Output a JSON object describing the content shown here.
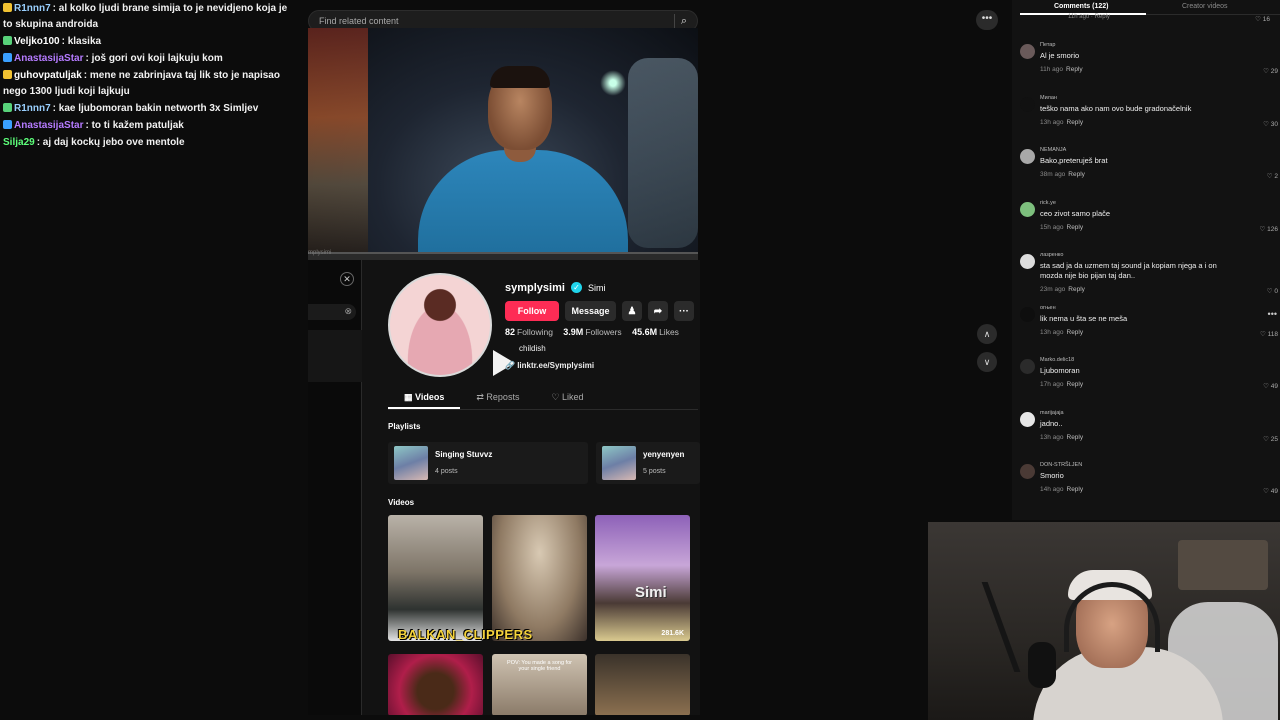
{
  "chat": {
    "messages": [
      {
        "user": "R1nnn7",
        "user_color": "#9ad0ff",
        "badge_color": "#f1c232",
        "text": ": al kolko ljudi brane simija to je nevidjeno koja je to skupina androida"
      },
      {
        "user": "Veljko100",
        "user_color": "#ffffff",
        "badge_color": "#58d27a",
        "text": ": klasika"
      },
      {
        "user": "AnastasijaStar",
        "user_color": "#b57bff",
        "badge_color": "#3aa0ff",
        "text": ": još gori ovi koji lajkuju kom"
      },
      {
        "user": "guhovpatuljak",
        "user_color": "#ffffff",
        "badge_color": "#f1c232",
        "text": ": mene ne zabrinjava taj lik sto je napisao nego 1300 ljudi koji lajkuju"
      },
      {
        "user": "R1nnn7",
        "user_color": "#9ad0ff",
        "badge_color": "#58d27a",
        "text": ": kae ljubomoran bakin networth 3x Simljev"
      },
      {
        "user": "AnastasijaStar",
        "user_color": "#b57bff",
        "badge_color": "#3aa0ff",
        "text": ": to ti kažem patuljak"
      },
      {
        "user": "Silja29",
        "user_color": "#5dff7a",
        "badge_color": "",
        "text": ": aj daj kockų jebo ove mentole"
      }
    ]
  },
  "search": {
    "placeholder": "Find related content",
    "icon": "search-icon"
  },
  "video": {
    "label": "mplysimi",
    "progress_pct": 100
  },
  "profile": {
    "username": "symplysimi",
    "nickname": "Simi",
    "follow_label": "Follow",
    "message_label": "Message",
    "following_count": "82",
    "following_label": "Following",
    "followers_count": "3.9M",
    "followers_label": "Followers",
    "likes_count": "45.6M",
    "likes_label": "Likes",
    "bio": "childish",
    "link": "linktr.ee/Symplysimi",
    "tabs": [
      "Videos",
      "Reposts",
      "Liked"
    ],
    "playlists_label": "Playlists",
    "playlists": [
      {
        "name": "Singing Stuvvz",
        "count": "4 posts"
      },
      {
        "name": "yenyenyen",
        "count": "5 posts"
      }
    ],
    "videos_label": "Videos",
    "videos": [
      {
        "views": ""
      },
      {
        "views": ""
      },
      {
        "views": "281.6K"
      }
    ],
    "watermark": "BALKAN_CLIPPERS",
    "simi_overlay": "Simi",
    "pov_text": "POV: You made a song for your single friend"
  },
  "comments_panel": {
    "tabs": [
      "Comments (122)",
      "Creator videos"
    ],
    "prev_meta": "11h ago · Reply",
    "prev_likes": "16",
    "items": [
      {
        "user": "Петар",
        "text": "Al je smorio",
        "time": "11h ago",
        "reply": "Reply",
        "likes": "29",
        "avatar": "#6a5a5a"
      },
      {
        "user": "Милан",
        "text": "teško nama ako nam ovo bude gradonačelnik",
        "time": "13h ago",
        "reply": "Reply",
        "likes": "30",
        "avatar": "#111111"
      },
      {
        "user": "NEMANJA",
        "text": "Bako,preteruješ brat",
        "time": "38m ago",
        "reply": "Reply",
        "likes": "2",
        "avatar": "#a8a8a8"
      },
      {
        "user": "rick.ye",
        "text": "ceo zivot samo plače",
        "time": "15h ago",
        "reply": "Reply",
        "likes": "126",
        "avatar": "#7dbf7d"
      },
      {
        "user": "лазренко",
        "text": "sta sad ja da uzmem taj sound ja kopiam njega a i on mozda nije bio pijan taj dan..",
        "time": "23m ago",
        "reply": "Reply",
        "likes": "0",
        "avatar": "#dcdcdc"
      },
      {
        "user": "огњен",
        "text": "lik nema u šta se ne meša",
        "time": "13h ago",
        "reply": "Reply",
        "likes": "118",
        "avatar": "#0e0e0e"
      },
      {
        "user": "Marko.delic18",
        "text": "Ljubomoran",
        "time": "17h ago",
        "reply": "Reply",
        "likes": "49",
        "avatar": "#2b2b2b"
      },
      {
        "user": "marijajaja",
        "text": "jadno..",
        "time": "13h ago",
        "reply": "Reply",
        "likes": "25",
        "avatar": "#e6e6e6"
      },
      {
        "user": "DON-STRŠLJEN",
        "text": "Smorio",
        "time": "14h ago",
        "reply": "Reply",
        "likes": "49",
        "avatar": "#4a3a35"
      }
    ]
  },
  "nav": {
    "more": "•••",
    "up": "∧",
    "down": "∨"
  }
}
